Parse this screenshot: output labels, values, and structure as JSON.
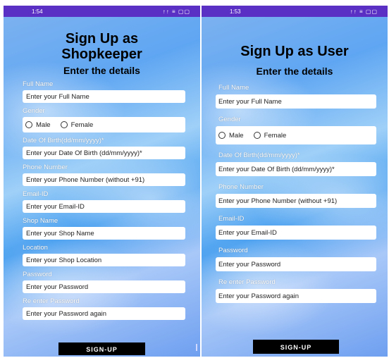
{
  "left": {
    "status_time": "1:54",
    "status_icons": "↑↑ ≡ ▢▢",
    "title_line1": "Sign Up as",
    "title_line2": "Shopkeeper",
    "subtitle": "Enter the details",
    "labels": {
      "full_name": "Full Name",
      "gender": "Gender",
      "dob": "Date Of Birth(dd/mm/yyyy)*",
      "phone": "Phone Number",
      "email": "Email-ID",
      "shop_name": "Shop Name",
      "location": "Location",
      "password": "Password",
      "reenter": "Re enter Password"
    },
    "placeholders": {
      "full_name": "Enter your Full Name",
      "dob": "Enter your Date Of Birth (dd/mm/yyyy)*",
      "phone": "Enter your Phone Number (without +91)",
      "email": "Enter your Email-ID",
      "shop_name": "Enter your Shop Name",
      "location": "Enter your Shop Location",
      "password": "Enter your Password",
      "reenter": "Enter your Password again"
    },
    "gender_options": [
      "Male",
      "Female"
    ],
    "button": "SIGN-UP"
  },
  "right": {
    "status_time": "1:53",
    "status_icons": "↑↑ ≡ ▢▢",
    "title": "Sign Up as User",
    "subtitle": "Enter the details",
    "labels": {
      "full_name": "Full Name",
      "gender": "Gender",
      "dob": "Date Of Birth(dd/mm/yyyy)*",
      "phone": "Phone Number",
      "email": "Email-ID",
      "password": "Password",
      "reenter": "Re enter Password"
    },
    "placeholders": {
      "full_name": "Enter your Full Name",
      "dob": "Enter your Date Of Birth (dd/mm/yyyy)*",
      "phone": "Enter your Phone Number (without +91)",
      "email": "Enter your Email-ID",
      "password": "Enter your Password",
      "reenter": "Enter your Password again"
    },
    "gender_options": [
      "Male",
      "Female"
    ],
    "button": "SIGN-UP"
  },
  "colors": {
    "status_bar": "#5a2fc4",
    "button": "#000000"
  }
}
